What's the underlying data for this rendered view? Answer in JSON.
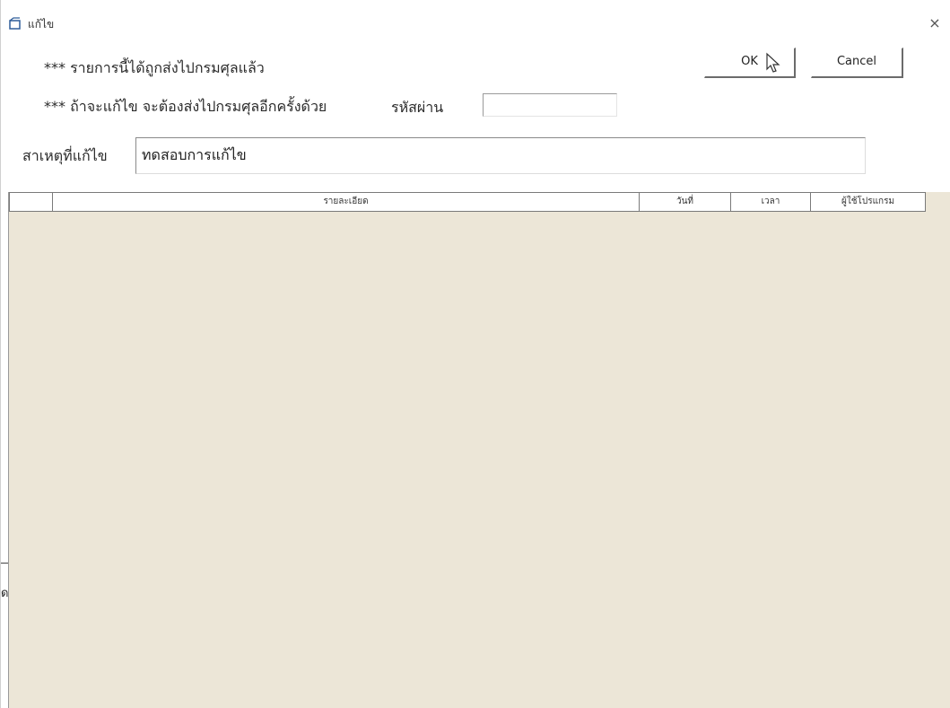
{
  "window": {
    "title": "แก้ไข",
    "close_symbol": "×"
  },
  "notices": {
    "line1": "*** รายการนี้ได้ถูกส่งไปกรมศุลแล้ว",
    "line2": "*** ถ้าจะแก้ไข จะต้องส่งไปกรมศุลอีกครั้งด้วย"
  },
  "password": {
    "label": "รหัสผ่าน",
    "value": ""
  },
  "buttons": {
    "ok": "OK",
    "cancel": "Cancel"
  },
  "reason": {
    "label": "สาเหตุที่แก้ไข",
    "value": "ทดสอบการแก้ไข"
  },
  "grid": {
    "columns": [
      "",
      "รายละเอียด",
      "วันที่",
      "เวลา",
      "ผู้ใช้โปรแกรม"
    ],
    "rows": [],
    "background": "#ece6d7"
  },
  "background_fragment": "ด"
}
